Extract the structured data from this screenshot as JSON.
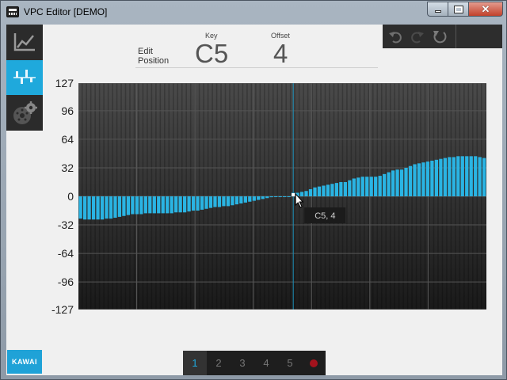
{
  "window": {
    "title": "VPC Editor [DEMO]",
    "close_glyph": "✕"
  },
  "header": {
    "edit_position_line1": "Edit",
    "edit_position_line2": "Position",
    "key_label": "Key",
    "key_value": "C5",
    "offset_label": "Offset",
    "offset_value": "4"
  },
  "sidebar": {
    "items": [
      {
        "icon": "line-graph-icon",
        "active": false
      },
      {
        "icon": "bar-adjust-icon",
        "active": true
      },
      {
        "icon": "settings-gear-icon",
        "active": false
      }
    ]
  },
  "toolbar": {
    "items": [
      "undo-icon",
      "redo-icon",
      "reset-icon"
    ]
  },
  "brand": {
    "logo_text": "KAWAI",
    "accent": "#1fa9dc"
  },
  "chart_data": {
    "type": "bar",
    "yticks": [
      127,
      96,
      64,
      32,
      0,
      -32,
      -64,
      -96,
      -127
    ],
    "ylim": [
      -127,
      127
    ],
    "bar_color": "#2ab4e3",
    "cursor_label": "C5, 4",
    "cursor_index": 49,
    "values": [
      -25,
      -26,
      -26,
      -26,
      -26,
      -26,
      -25,
      -25,
      -24,
      -23,
      -22,
      -21,
      -20,
      -20,
      -20,
      -19,
      -19,
      -19,
      -19,
      -19,
      -19,
      -19,
      -18,
      -18,
      -18,
      -17,
      -16,
      -16,
      -15,
      -14,
      -13,
      -12,
      -12,
      -11,
      -11,
      -10,
      -9,
      -8,
      -7,
      -6,
      -5,
      -4,
      -3,
      -2,
      -1,
      0,
      0,
      0,
      0,
      4,
      4,
      5,
      6,
      8,
      10,
      11,
      12,
      13,
      14,
      15,
      16,
      16,
      18,
      20,
      21,
      22,
      22,
      22,
      22,
      23,
      25,
      27,
      29,
      30,
      30,
      32,
      34,
      36,
      37,
      38,
      39,
      40,
      41,
      42,
      43,
      44,
      44,
      45,
      45,
      45,
      45,
      45,
      44,
      43
    ]
  },
  "pager": {
    "pages": [
      "1",
      "2",
      "3",
      "4",
      "5"
    ],
    "current": "1"
  }
}
